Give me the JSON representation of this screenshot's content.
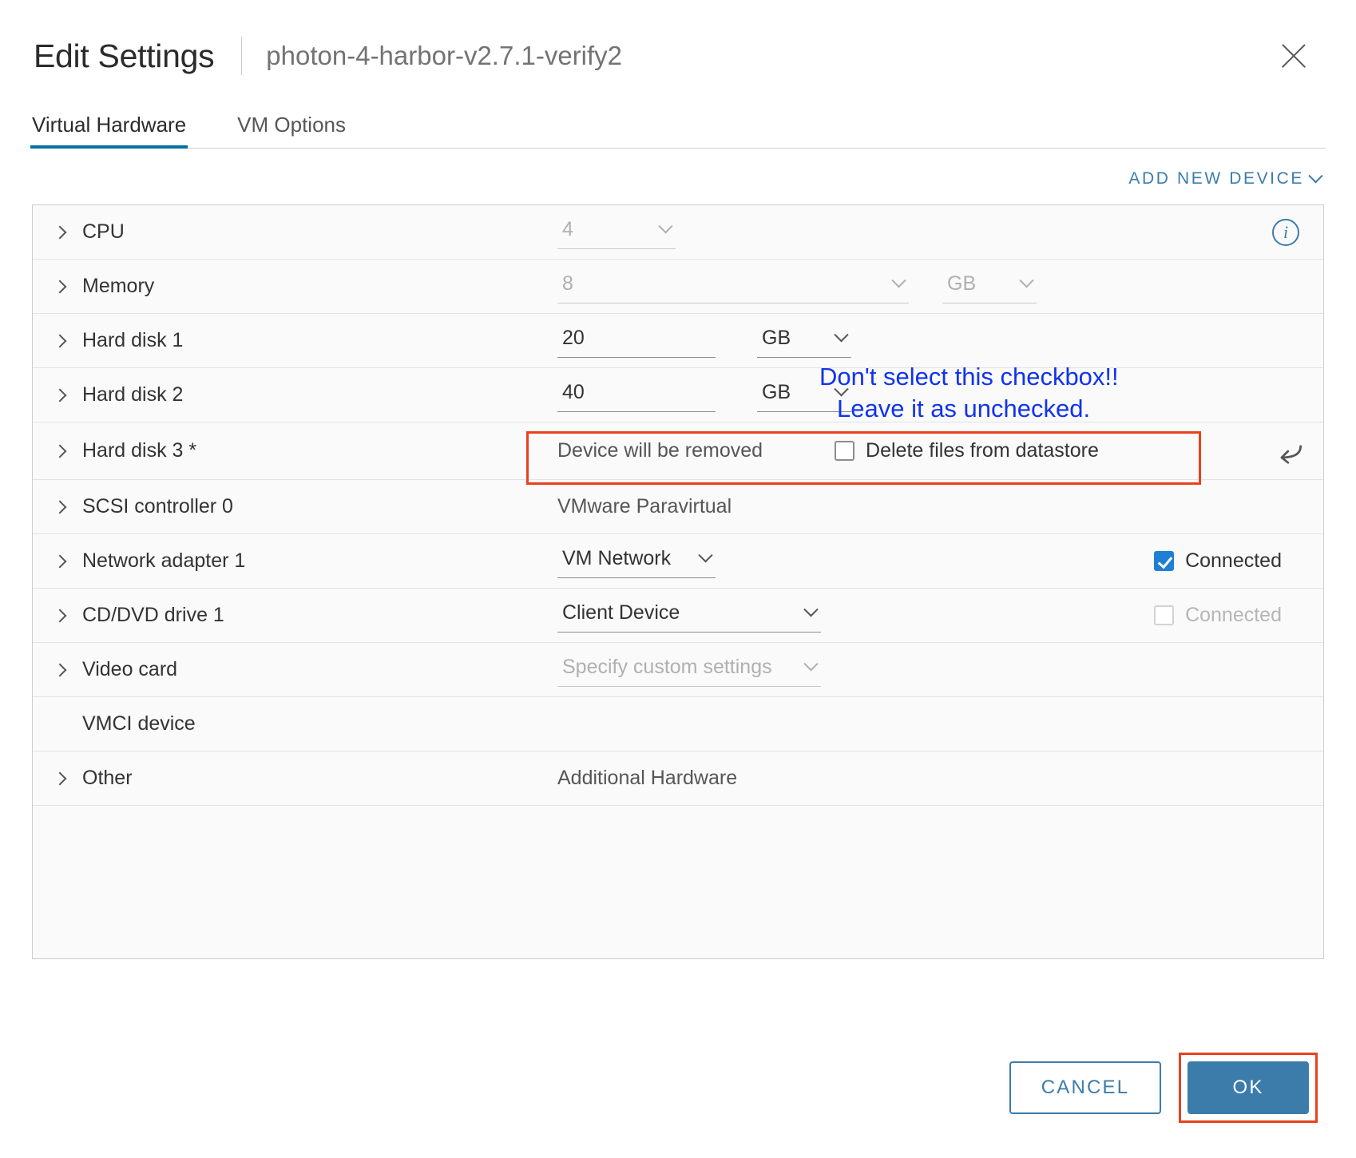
{
  "header": {
    "title": "Edit Settings",
    "vm_name": "photon-4-harbor-v2.7.1-verify2",
    "close_label": "×"
  },
  "tabs": [
    {
      "label": "Virtual Hardware",
      "active": true
    },
    {
      "label": "VM Options",
      "active": false
    }
  ],
  "toolbar": {
    "add_new_device": "ADD NEW DEVICE"
  },
  "rows": {
    "cpu": {
      "label": "CPU",
      "value": "4",
      "info_icon": "info-circle-icon"
    },
    "memory": {
      "label": "Memory",
      "value": "8",
      "unit": "GB"
    },
    "hard_disk_1": {
      "label": "Hard disk 1",
      "value": "20",
      "unit": "GB"
    },
    "hard_disk_2": {
      "label": "Hard disk 2",
      "value": "40",
      "unit": "GB"
    },
    "hard_disk_3": {
      "label": "Hard disk 3 *",
      "status": "Device will be removed",
      "checkbox_label": "Delete files from datastore",
      "checkbox_checked": false,
      "revert_icon": "revert-arrow-icon"
    },
    "scsi_controller_0": {
      "label": "SCSI controller 0",
      "value": "VMware Paravirtual"
    },
    "network_adapter_1": {
      "label": "Network adapter 1",
      "value": "VM Network",
      "connected_label": "Connected",
      "connected_checked": true
    },
    "cd_dvd_drive_1": {
      "label": "CD/DVD drive 1",
      "value": "Client Device",
      "connected_label": "Connected",
      "connected_checked": false
    },
    "video_card": {
      "label": "Video card",
      "value": "Specify custom settings"
    },
    "vmci_device": {
      "label": "VMCI device"
    },
    "other": {
      "label": "Other",
      "value": "Additional Hardware"
    }
  },
  "annotation": {
    "line1": "Don't select this checkbox!!",
    "line2": "Leave it as unchecked.",
    "color": "#1133ee",
    "highlight_color": "#e8411f"
  },
  "footer": {
    "cancel_label": "CANCEL",
    "ok_label": "OK"
  }
}
